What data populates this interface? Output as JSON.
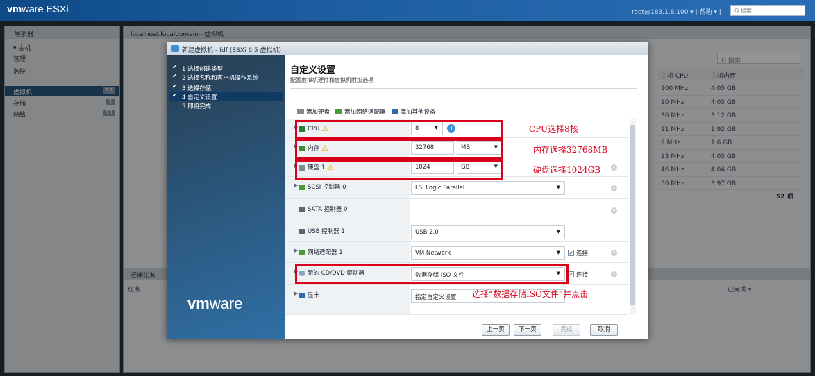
{
  "topbar": {
    "logo_vm": "vm",
    "logo_ware": "ware",
    "logo_product": " ESXi",
    "user": "root@183.1.8.100 ▾ | 帮助 ▾ | ",
    "search_placeholder": "Q 搜索"
  },
  "navigator": {
    "title": "导航器",
    "items": [
      {
        "label": "▾ 主机",
        "badge": ""
      },
      {
        "label": "   管理",
        "badge": ""
      },
      {
        "label": "   监控",
        "badge": ""
      },
      {
        "label": "虚拟机",
        "badge": "52"
      },
      {
        "label": "存储",
        "badge": "1"
      },
      {
        "label": "网络",
        "badge": "13"
      }
    ]
  },
  "main": {
    "breadcrumb": "localhost.localdomain - 虚拟机",
    "search": "Q 搜索",
    "columns": [
      "主机 CPU",
      "主机内存"
    ],
    "rows": [
      [
        "100 MHz",
        "4.05 GB"
      ],
      [
        "10 MHz",
        "4.05 GB"
      ],
      [
        "36 MHz",
        "3.12 GB"
      ],
      [
        "11 MHz",
        "1.92 GB"
      ],
      [
        "9 MHz",
        "1.6 GB"
      ],
      [
        "13 MHz",
        "4.05 GB"
      ],
      [
        "46 MHz",
        "4.04 GB"
      ],
      [
        "50 MHz",
        "3.97 GB"
      ]
    ],
    "count": "52 项",
    "recent": "近期任务",
    "recent_col": "任务",
    "completed": "已完成 ▾"
  },
  "dialog": {
    "title": "新建虚拟机 - fdf (ESXi 6.5 虚拟机)",
    "steps": [
      {
        "num": "1",
        "label": "选择创建类型",
        "done": true
      },
      {
        "num": "2",
        "label": "选择名称和客户机操作系统",
        "done": true
      },
      {
        "num": "3",
        "label": "选择存储",
        "done": true
      },
      {
        "num": "4",
        "label": "自定义设置",
        "done": true
      },
      {
        "num": "5",
        "label": "即将完成",
        "done": false
      }
    ],
    "vm_logo_bold": "vm",
    "vm_logo_rest": "ware",
    "heading": "自定义设置",
    "subheading": "配置虚拟机硬件和虚拟机附加选项",
    "toolbar": {
      "add_disk": "添加硬盘",
      "add_nic": "添加网络适配器",
      "add_other": "添加其他设备"
    },
    "cpu": {
      "label": "CPU",
      "value": "8"
    },
    "memory": {
      "label": "内存",
      "value": "32768",
      "unit": "MB"
    },
    "disk": {
      "label": "硬盘 1",
      "value": "1024",
      "unit": "GB"
    },
    "scsi": {
      "label": "SCSI 控制器 0",
      "value": "LSI Logic Parallel"
    },
    "sata": {
      "label": "SATA 控制器 0"
    },
    "usb": {
      "label": "USB 控制器 1",
      "value": "USB 2.0"
    },
    "nic": {
      "label": "网络适配器 1",
      "value": "VM Network",
      "connect": "连接"
    },
    "cdrom": {
      "label": "新的 CD/DVD 驱动器",
      "value": "数据存储 ISO 文件",
      "connect": "连接"
    },
    "video": {
      "label": "显卡",
      "value": "指定自定义设置"
    },
    "buttons": {
      "back": "上一页",
      "next": "下一页",
      "finish": "完成",
      "cancel": "取消"
    }
  },
  "annotations": {
    "cpu": "CPU选择8核",
    "memory": "内存选择32768MB",
    "disk": "硬盘选择1024GB",
    "iso": "选择“数据存储ISO文件”并点击"
  },
  "colors": {
    "annotation": "#d9001b",
    "accent": "#2a5680"
  }
}
